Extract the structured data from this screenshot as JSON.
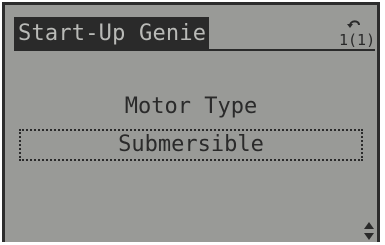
{
  "display": {
    "title": "Start-Up Genie",
    "menu_level": "1(1)",
    "parameter_label": "Motor Type",
    "parameter_value": "Submersible"
  },
  "icons": {
    "back": "back-arrow-icon",
    "scroll": "up-down-scroll-icon"
  },
  "colors": {
    "lcd_background": "#999a97",
    "lcd_foreground": "#2a2a2a",
    "title_text": "#b9bab7"
  }
}
